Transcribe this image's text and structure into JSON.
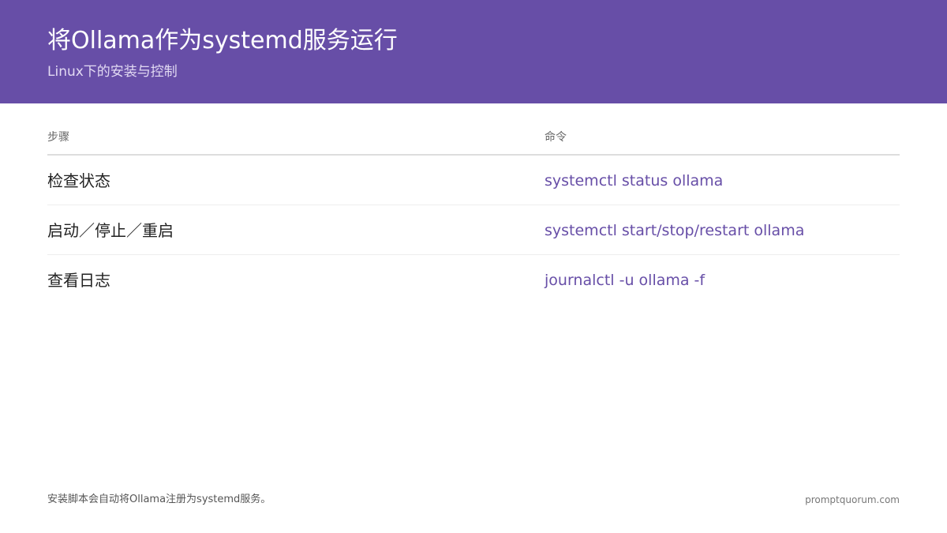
{
  "header": {
    "title": "将Ollama作为systemd服务运行",
    "subtitle": "Linux下的安装与控制"
  },
  "table": {
    "columns": [
      "步骤",
      "命令"
    ],
    "rows": [
      {
        "step": "检查状态",
        "command": "systemctl status ollama"
      },
      {
        "step": "启动／停止／重启",
        "command": "systemctl start/stop/restart ollama"
      },
      {
        "step": "查看日志",
        "command": "journalctl -u ollama -f"
      }
    ]
  },
  "footer": {
    "note": "安装脚本会自动将Ollama注册为systemd服务。",
    "site": "promptquorum.com"
  },
  "colors": {
    "header_bg": "#674ea7",
    "accent": "#674ea7"
  }
}
